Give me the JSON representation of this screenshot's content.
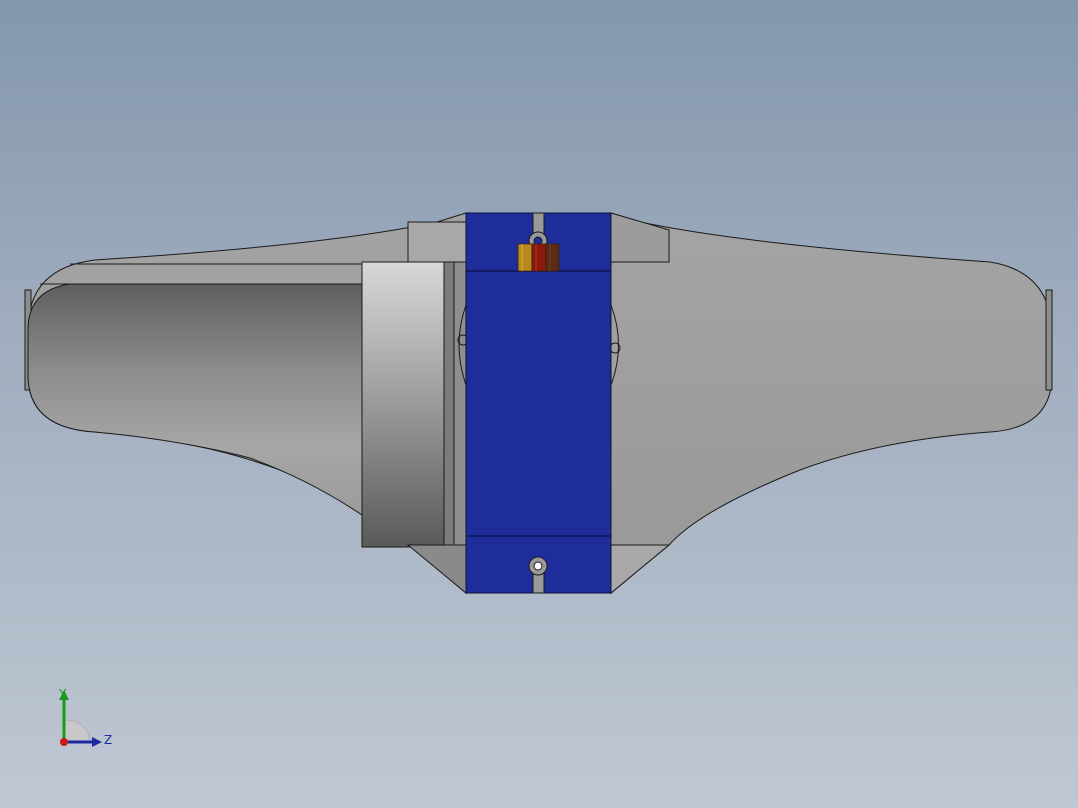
{
  "viewport": {
    "background_top": "#8497ae",
    "background_bottom": "#bfc7d2"
  },
  "model": {
    "body_color": "#9a9a9a",
    "body_shade_color": "#6e6e6e",
    "servo_color": "#1e2d9a",
    "gear_colors": [
      "#b88a1e",
      "#8a1a10",
      "#5a2c14"
    ]
  },
  "triad": {
    "y_label": "Y",
    "z_label": "Z",
    "y_color": "#1a9a1a",
    "z_color": "#1a2aa0",
    "x_color": "#cc1a1a"
  }
}
